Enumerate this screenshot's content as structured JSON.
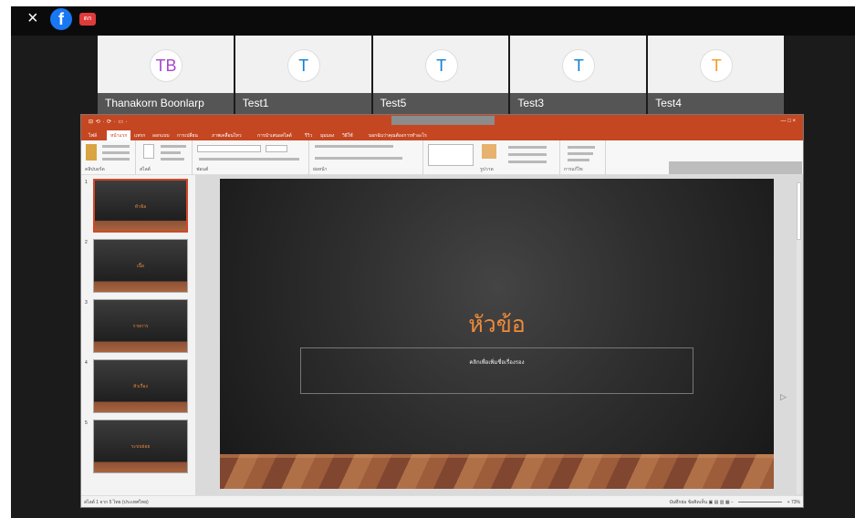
{
  "overlay": {
    "close_label": "×",
    "facebook_label": "f",
    "live_label": "ดก"
  },
  "participants": [
    {
      "initials": "TB",
      "name": "Thanakorn Boonlarp",
      "color": "#a646c8"
    },
    {
      "initials": "T",
      "name": "Test1",
      "color": "#0e7fd6"
    },
    {
      "initials": "T",
      "name": "Test5",
      "color": "#0e7fd6"
    },
    {
      "initials": "T",
      "name": "Test3",
      "color": "#0e7fd6"
    },
    {
      "initials": "T",
      "name": "Test4",
      "color": "#f39a21"
    }
  ],
  "powerpoint": {
    "title_left": "⊟ ⟲ · ⟳ · ▭ ·",
    "window_controls": "— □ ×",
    "tabs": [
      "ไฟล์",
      "หน้าแรก",
      "แทรก",
      "ออกแบบ",
      "การเปลี่ยน",
      "ภาพเคลื่อนไหว",
      "การนำเสนอสไลด์",
      "รีวิว",
      "มุมมอง",
      "วิธีใช้",
      "บอกฉันว่าคุณต้องการทำอะไร"
    ],
    "ribbon_groups": [
      "คลิปบอร์ด",
      "สไลด์",
      "ฟอนต์",
      "ย่อหน้า",
      "รูปวาด",
      "การแก้ไข"
    ],
    "slides": [
      {
        "number": "1",
        "label": "หัวข้อ"
      },
      {
        "number": "2",
        "label": "เนื้อ"
      },
      {
        "number": "3",
        "label": "รายการ"
      },
      {
        "number": "4",
        "label": "หัวเรื่อง"
      },
      {
        "number": "5",
        "label": "ระบบย่อย"
      }
    ],
    "slide": {
      "title": "หัวข้อ",
      "subtitle": "คลิกเพื่อเพิ่มชื่อเรื่องรอง"
    },
    "status": {
      "left": "สไลด์ 1 จาก 5   ไทย (ประเทศไทย)",
      "right": "บันทึกย่อ   ข้อคิดเห็น   ▣  ▤  ▥  ▦  −",
      "zoom": "+  73%"
    }
  },
  "colors": {
    "accent": "#c54722",
    "slide_title": "#ef8b38"
  }
}
